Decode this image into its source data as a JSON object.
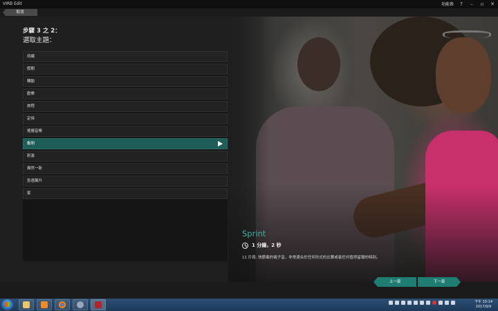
{
  "app": {
    "title": "VIRB Edit",
    "topbar_link": "功能表",
    "win_controls": {
      "help": "?",
      "minimize": "–",
      "restore": "▫",
      "close": "✕"
    }
  },
  "back": {
    "cancel_label": "取消"
  },
  "step": {
    "label": "步驟 3 之 2：",
    "subtitle": "選取主題："
  },
  "themes": [
    {
      "label": "持續"
    },
    {
      "label": "假期"
    },
    {
      "label": "轉動"
    },
    {
      "label": "歡樂"
    },
    {
      "label": "旅程"
    },
    {
      "label": "定時"
    },
    {
      "label": "搖擺音樂"
    },
    {
      "label": "衝刺"
    },
    {
      "label": "刺激"
    },
    {
      "label": "煥然一新"
    },
    {
      "label": "急速飆升"
    },
    {
      "label": "家"
    }
  ],
  "selected_index": 7,
  "detail": {
    "title": "Sprint",
    "duration": "1 分鐘，2 秒",
    "description": "11 片段, 快節奏的電子音，非常適合於任何形式的比賽或者任何值得留獵的時刻。"
  },
  "nav": {
    "prev_label": "上一頁",
    "next_label": "下一頁"
  },
  "taskbar": {
    "clock_time": "下午 10:14",
    "clock_date": "2017/9/9"
  },
  "colors": {
    "accent": "#1f7d72",
    "selected_row": "#1f5d58",
    "title_teal": "#3fb2a6"
  },
  "icons": {
    "play": "play-icon",
    "clock": "clock-icon",
    "start": "windows-start-icon"
  }
}
